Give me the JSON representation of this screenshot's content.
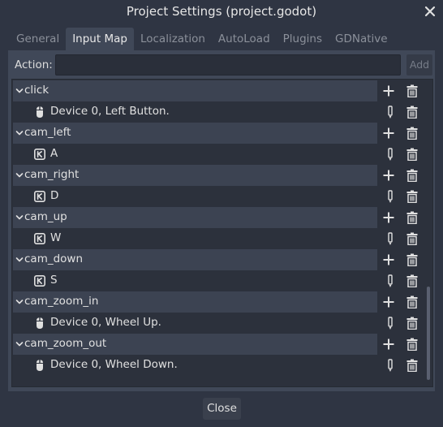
{
  "window": {
    "title": "Project Settings (project.godot)"
  },
  "tabs": [
    {
      "label": "General"
    },
    {
      "label": "Input Map"
    },
    {
      "label": "Localization"
    },
    {
      "label": "AutoLoad"
    },
    {
      "label": "Plugins"
    },
    {
      "label": "GDNative"
    }
  ],
  "action_bar": {
    "label": "Action:",
    "input_value": "",
    "add_label": "Add"
  },
  "rows": [
    {
      "kind": "action",
      "label": "click"
    },
    {
      "kind": "event",
      "icon": "mouse-icon",
      "label": "Device 0, Left Button."
    },
    {
      "kind": "action",
      "label": "cam_left"
    },
    {
      "kind": "event",
      "icon": "keyboard-key-icon",
      "label": "A"
    },
    {
      "kind": "action",
      "label": "cam_right"
    },
    {
      "kind": "event",
      "icon": "keyboard-key-icon",
      "label": "D"
    },
    {
      "kind": "action",
      "label": "cam_up"
    },
    {
      "kind": "event",
      "icon": "keyboard-key-icon",
      "label": "W"
    },
    {
      "kind": "action",
      "label": "cam_down"
    },
    {
      "kind": "event",
      "icon": "keyboard-key-icon",
      "label": "S"
    },
    {
      "kind": "action",
      "label": "cam_zoom_in"
    },
    {
      "kind": "event",
      "icon": "mouse-icon",
      "label": "Device 0, Wheel Up."
    },
    {
      "kind": "action",
      "label": "cam_zoom_out"
    },
    {
      "kind": "event",
      "icon": "mouse-icon",
      "label": "Device 0, Wheel Down."
    }
  ],
  "footer": {
    "close_label": "Close"
  },
  "colors": {
    "background": "#2f3543",
    "panel": "#404858",
    "tree_background": "#2c313c",
    "action_row": "#3c4352",
    "icon": "#e0e0e0"
  }
}
